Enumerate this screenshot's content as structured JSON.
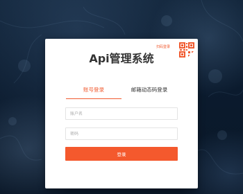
{
  "app": {
    "title": "Api管理系统"
  },
  "qr_login": {
    "hint": "扫码登录",
    "icon": "qr-code-icon",
    "color": "#f0592e"
  },
  "tabs": [
    {
      "label": "账号登录",
      "active": true
    },
    {
      "label": "邮箱动态码登录",
      "active": false
    }
  ],
  "form": {
    "account_placeholder": "账户名",
    "account_value": "",
    "password_placeholder": "密码",
    "password_value": "",
    "submit_label": "登录"
  },
  "colors": {
    "accent": "#f4592d",
    "background": "#0b1b2e",
    "card": "#ffffff"
  }
}
